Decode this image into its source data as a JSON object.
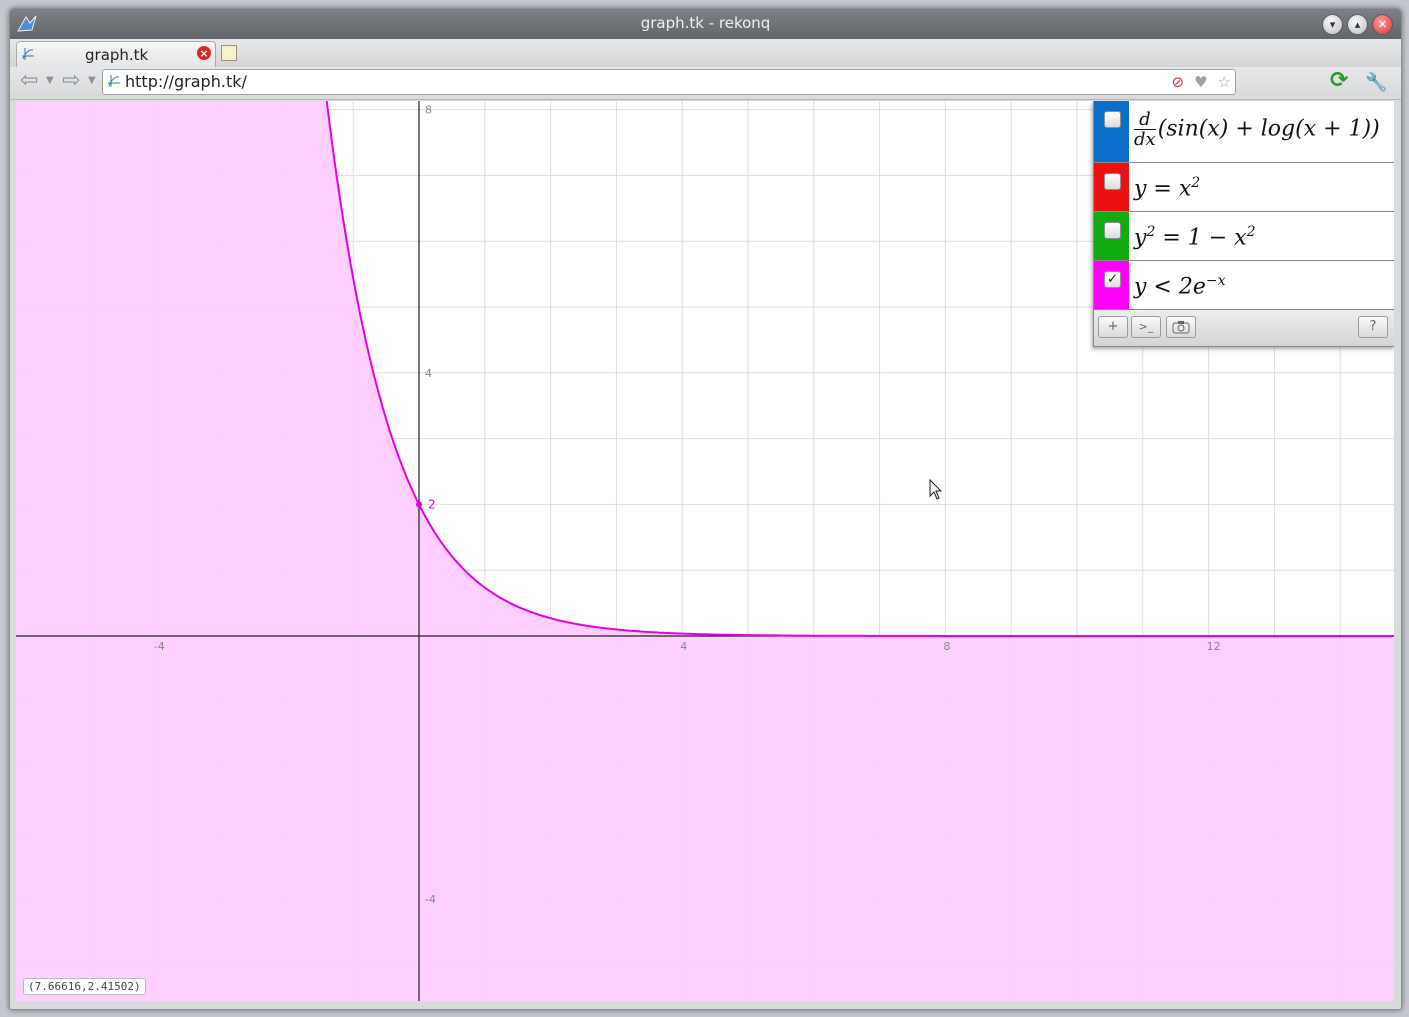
{
  "window": {
    "title": "graph.tk - rekonq",
    "buttons": [
      "minimize",
      "maximize",
      "close"
    ]
  },
  "tabs": [
    {
      "label": "graph.tk",
      "icon": "graph-favicon"
    }
  ],
  "toolbar": {
    "url": "http://graph.tk/",
    "icons": [
      "adblock-icon",
      "bookmark-heart-icon",
      "star-icon"
    ]
  },
  "graph": {
    "x_ticks": [
      "-4",
      "4",
      "8",
      "12"
    ],
    "y_ticks": [
      "8",
      "4",
      "-4"
    ],
    "intercept_label": "2",
    "coords_readout": "(7.66616,2.41502)",
    "shade_color": "#ffccff",
    "curve_color": "#e600e6"
  },
  "functions": [
    {
      "id": "derivative",
      "color": "#0a6fc8",
      "checked": false,
      "frac_top": "d",
      "frac_bot": "dx",
      "expr": "(sin(x) + log(x + 1))"
    },
    {
      "id": "parabola",
      "color": "#ee1111",
      "checked": false,
      "expr": "y = x",
      "sup": "2"
    },
    {
      "id": "circle",
      "color": "#11aa11",
      "checked": false,
      "expr_a": "y",
      "sup_a": "2",
      "expr_b": " = 1 − x",
      "sup_b": "2"
    },
    {
      "id": "inequality",
      "color": "#ff00ff",
      "checked": true,
      "expr": "y < 2e",
      "sup": "−x"
    }
  ],
  "panel_toolbar": {
    "add": "+",
    "console": ">_",
    "help": "?"
  }
}
